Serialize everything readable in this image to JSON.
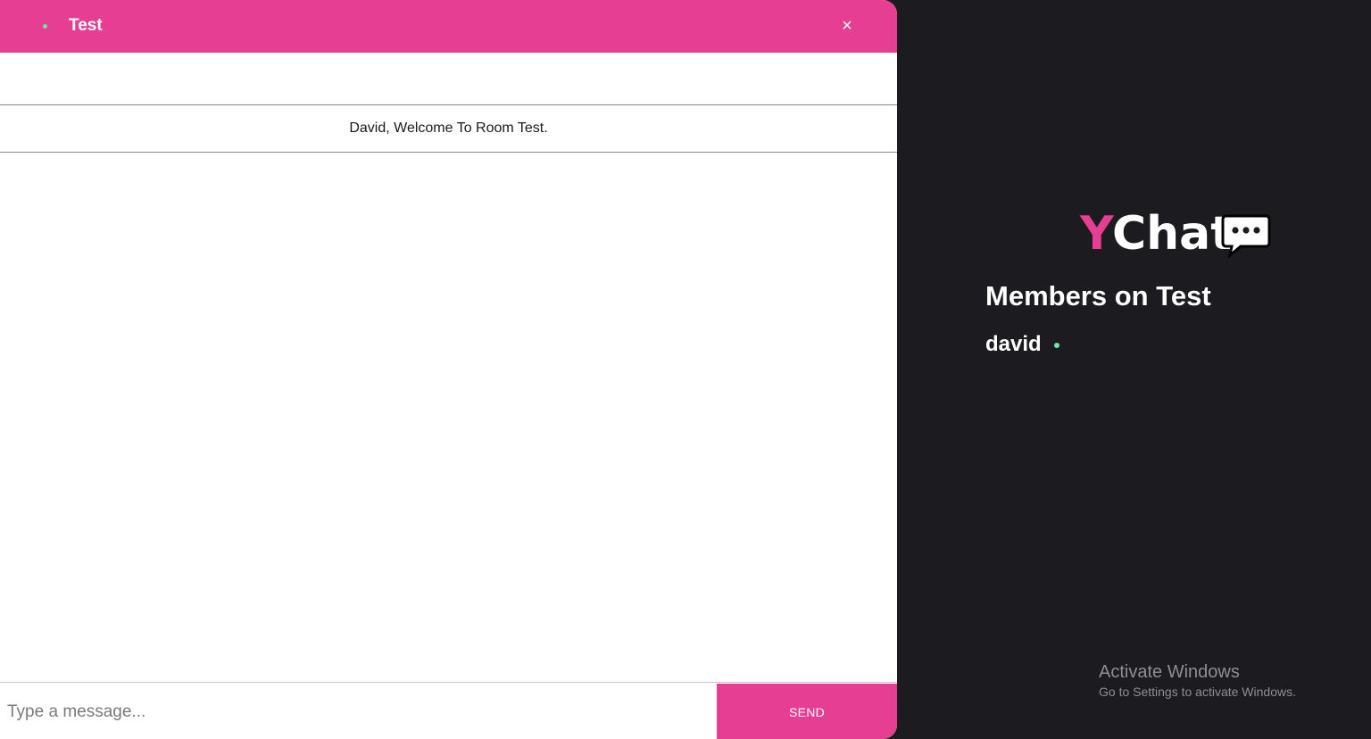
{
  "chat": {
    "room_title": "Test",
    "close_label": "×",
    "welcome_message": "David, Welcome To Room Test.",
    "input": {
      "placeholder": "Type a message...",
      "value": ""
    },
    "send_label": "SEND"
  },
  "sidebar": {
    "logo": {
      "first_letter": "Y",
      "rest": "Chat",
      "icon": "chat-bubble-icon"
    },
    "members_title": "Members on Test",
    "members": [
      {
        "name": "david",
        "status": "online"
      }
    ]
  },
  "overlay": {
    "activate_title": "Activate Windows",
    "activate_sub": "Go to Settings to activate Windows."
  },
  "colors": {
    "accent": "#e63e93",
    "sidebar_bg": "#1c1b20",
    "online": "#6ee7a6"
  }
}
